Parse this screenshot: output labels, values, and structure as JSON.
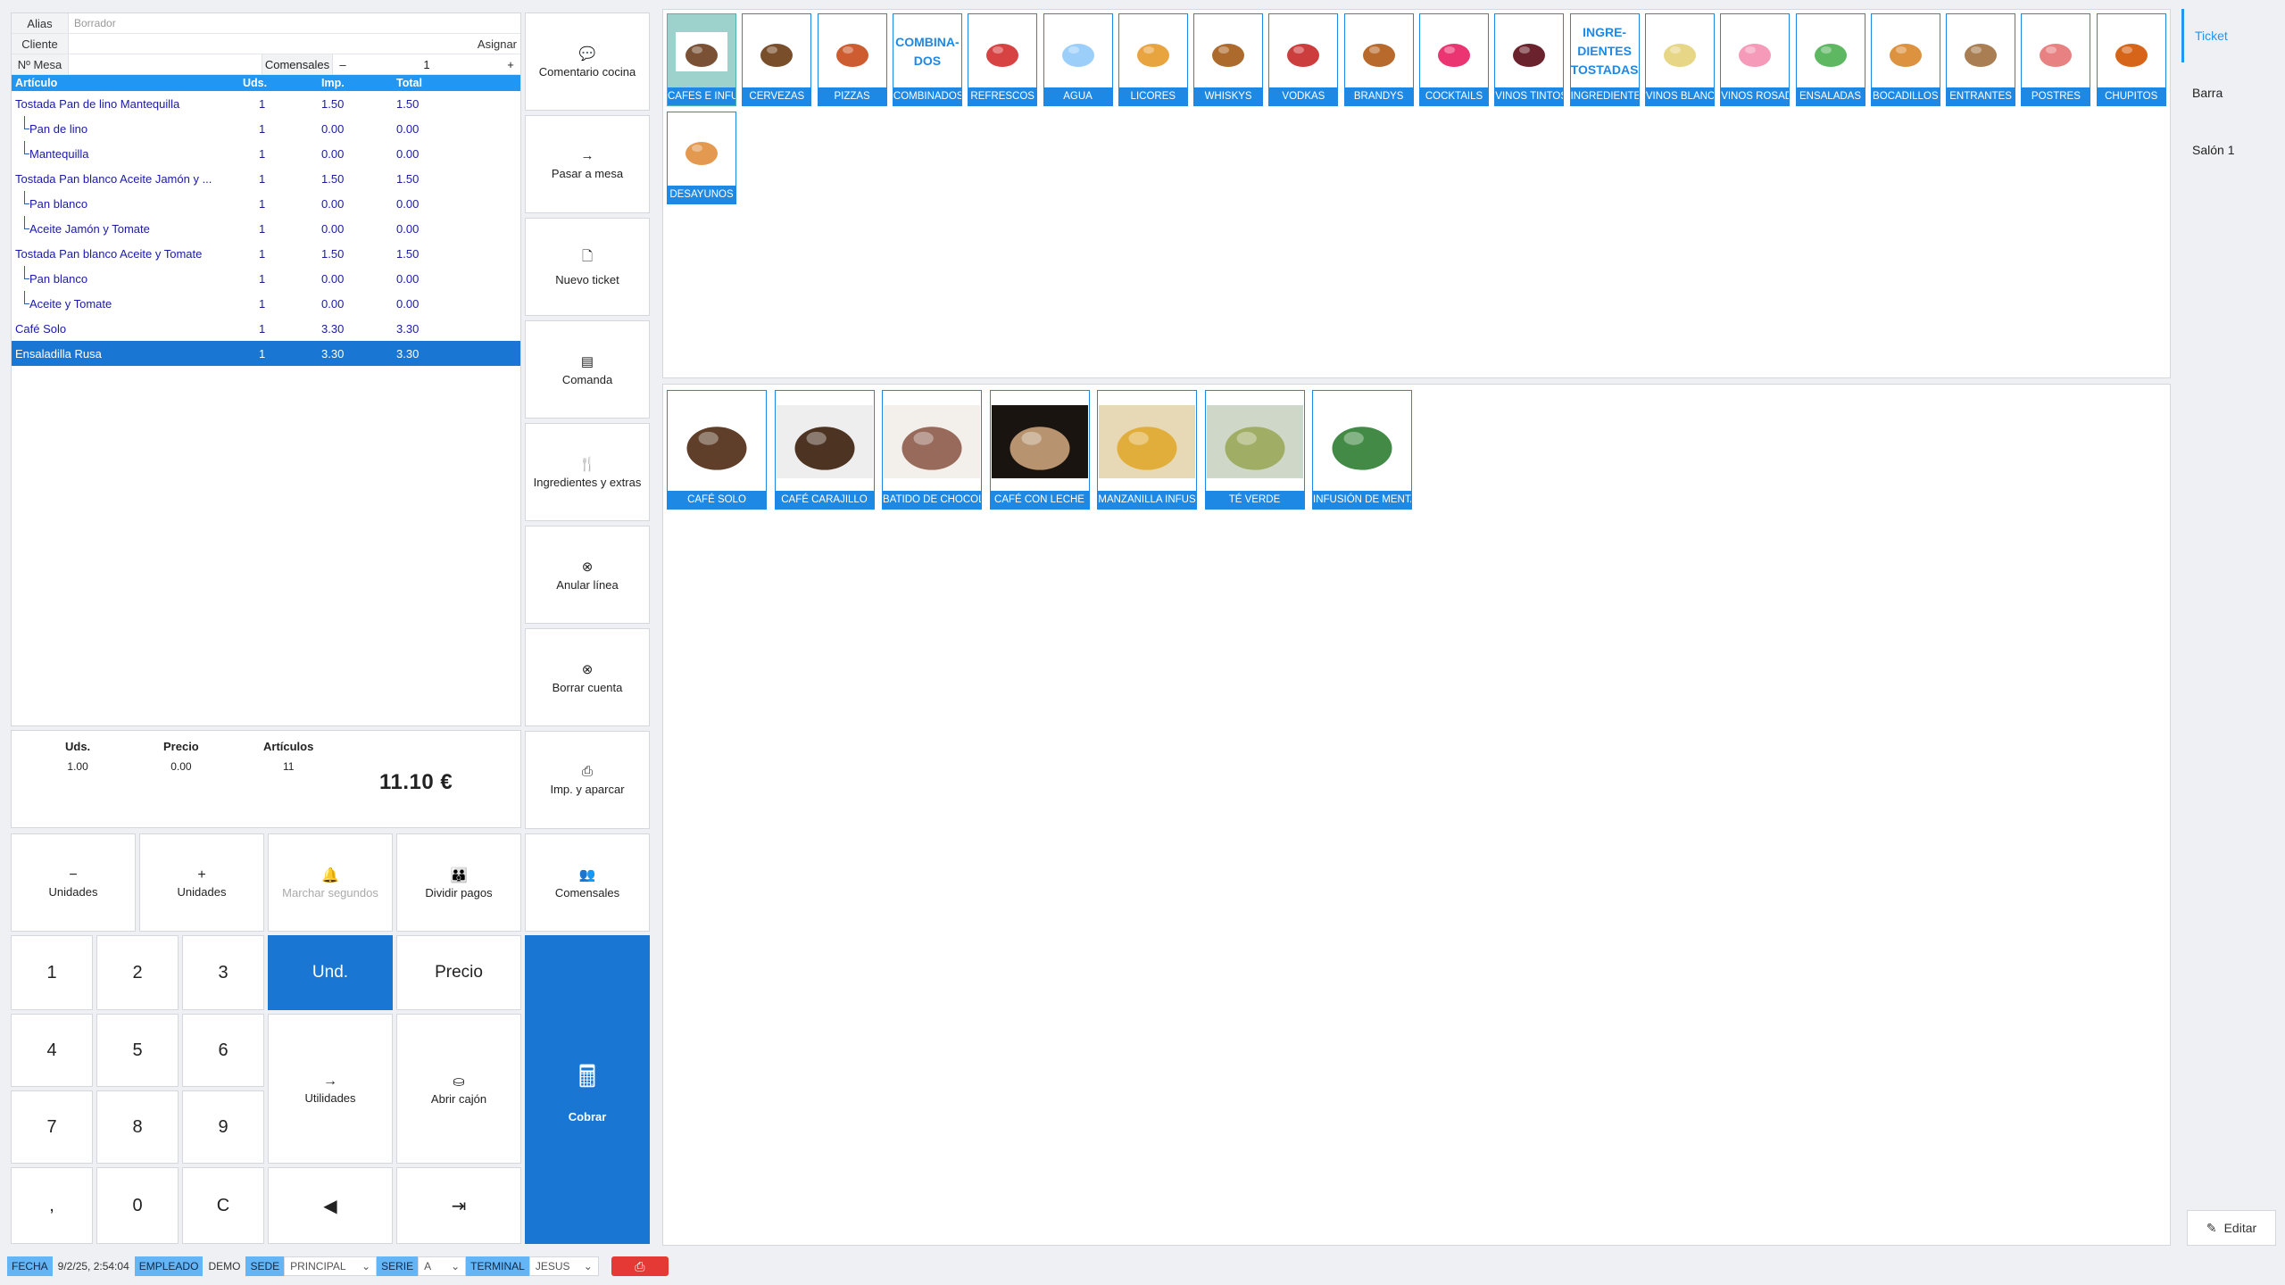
{
  "header": {
    "alias_label": "Alias",
    "alias_placeholder": "Borrador",
    "client_label": "Cliente",
    "assign_label": "Asignar",
    "table_label": "Nº Mesa",
    "covers_label": "Comensales",
    "covers_minus": "–",
    "covers_value": "1",
    "covers_plus": "+"
  },
  "ticket": {
    "columns": [
      "Artículo",
      "Uds.",
      "Imp.",
      "Total"
    ],
    "rows": [
      {
        "name": "Tostada Pan de lino Mantequilla",
        "units": "1",
        "price": "1.50",
        "total": "1.50",
        "child": false
      },
      {
        "name": "Pan de lino",
        "units": "1",
        "price": "0.00",
        "total": "0.00",
        "child": true
      },
      {
        "name": "Mantequilla",
        "units": "1",
        "price": "0.00",
        "total": "0.00",
        "child": true
      },
      {
        "name": "Tostada Pan blanco Aceite Jamón y ...",
        "units": "1",
        "price": "1.50",
        "total": "1.50",
        "child": false
      },
      {
        "name": "Pan blanco",
        "units": "1",
        "price": "0.00",
        "total": "0.00",
        "child": true
      },
      {
        "name": "Aceite Jamón y Tomate",
        "units": "1",
        "price": "0.00",
        "total": "0.00",
        "child": true
      },
      {
        "name": "Tostada Pan blanco Aceite y Tomate",
        "units": "1",
        "price": "1.50",
        "total": "1.50",
        "child": false
      },
      {
        "name": "Pan blanco",
        "units": "1",
        "price": "0.00",
        "total": "0.00",
        "child": true
      },
      {
        "name": "Aceite y Tomate",
        "units": "1",
        "price": "0.00",
        "total": "0.00",
        "child": true
      },
      {
        "name": "Café Solo",
        "units": "1",
        "price": "3.30",
        "total": "3.30",
        "child": false
      },
      {
        "name": "Ensaladilla Rusa",
        "units": "1",
        "price": "3.30",
        "total": "3.30",
        "child": false,
        "selected": true
      }
    ]
  },
  "summary": {
    "units_label": "Uds.",
    "units_value": "1.00",
    "price_label": "Precio",
    "price_value": "0.00",
    "articles_label": "Artículos",
    "articles_value": "11",
    "total": "11.10 €"
  },
  "actions": {
    "kitchen_comment": "Comentario cocina",
    "move_table": "Pasar a mesa",
    "new_ticket": "Nuevo ticket",
    "order": "Comanda",
    "ingredients": "Ingredientes y extras",
    "cancel_line": "Anular línea",
    "delete_account": "Borrar cuenta",
    "print_park": "Imp. y aparcar",
    "covers": "Comensales",
    "charge": "Cobrar"
  },
  "keypad": {
    "minus_units": "Unidades",
    "plus_units": "Unidades",
    "mark_seconds": "Marchar segundos",
    "split_payments": "Dividir pagos",
    "und": "Und.",
    "price": "Precio",
    "utilities": "Utilidades",
    "open_drawer": "Abrir cajón",
    "digits": [
      "1",
      "2",
      "3",
      "4",
      "5",
      "6",
      "7",
      "8",
      "9",
      ",",
      "0",
      "C"
    ]
  },
  "categories": [
    {
      "label": "CAFES E INFU",
      "icon": "coffee-cup",
      "active": true
    },
    {
      "label": "CERVEZAS",
      "icon": "beer-bottles"
    },
    {
      "label": "PIZZAS",
      "icon": "pizza"
    },
    {
      "label": "COMBINADOS",
      "text": "COMBINA-\nDOS"
    },
    {
      "label": "REFRESCOS",
      "icon": "soda-bottles"
    },
    {
      "label": "AGUA",
      "icon": "water-bottle"
    },
    {
      "label": "LICORES",
      "icon": "liquor-bottles"
    },
    {
      "label": "WHISKYS",
      "icon": "whisky-bottles"
    },
    {
      "label": "VODKAS",
      "icon": "vodka-bottles"
    },
    {
      "label": "BRANDYS",
      "icon": "brandy-bottles"
    },
    {
      "label": "COCKTAILS",
      "icon": "cocktails"
    },
    {
      "label": "VINOS TINTOS",
      "icon": "red-wine"
    },
    {
      "label": "INGREDIENTES",
      "text": "INGRE-\nDIENTES\nTOSTADAS"
    },
    {
      "label": "VINOS BLANC",
      "icon": "white-wine"
    },
    {
      "label": "VINOS ROSAD",
      "icon": "rose-wine"
    },
    {
      "label": "ENSALADAS",
      "icon": "salad"
    },
    {
      "label": "BOCADILLOS",
      "icon": "sandwich"
    },
    {
      "label": "ENTRANTES",
      "icon": "starters"
    },
    {
      "label": "POSTRES",
      "icon": "desserts"
    },
    {
      "label": "CHUPITOS",
      "icon": "shot-glass"
    },
    {
      "label": "DESAYUNOS",
      "icon": "breakfast"
    }
  ],
  "products": [
    {
      "label": "CAFÉ SOLO",
      "icon": "espresso"
    },
    {
      "label": "CAFÉ CARAJILLO",
      "icon": "carajillo"
    },
    {
      "label": "BATIDO DE CHOCOL",
      "icon": "chocolate-shake"
    },
    {
      "label": "CAFÉ CON LECHE",
      "icon": "latte"
    },
    {
      "label": "MANZANILLA INFUS",
      "icon": "chamomile"
    },
    {
      "label": "TÉ VERDE",
      "icon": "green-tea"
    },
    {
      "label": "INFUSIÓN DE MENTA",
      "icon": "mint-box"
    }
  ],
  "side_nav": [
    "Ticket",
    "Barra",
    "Salón 1"
  ],
  "edit_label": "Editar",
  "status": {
    "date_label": "FECHA",
    "date_value": "9/2/25, 2:54:04",
    "employee_label": "EMPLEADO",
    "employee_value": "DEMO",
    "site_label": "SEDE",
    "site_value": "PRINCIPAL",
    "series_label": "SERIE",
    "series_value": "A",
    "terminal_label": "TERMINAL",
    "terminal_value": "JESUS"
  },
  "colors": {
    "accent": "#1976d2",
    "header": "#2196f3",
    "text_blue": "#1a1aa6",
    "print": "#e53935"
  }
}
